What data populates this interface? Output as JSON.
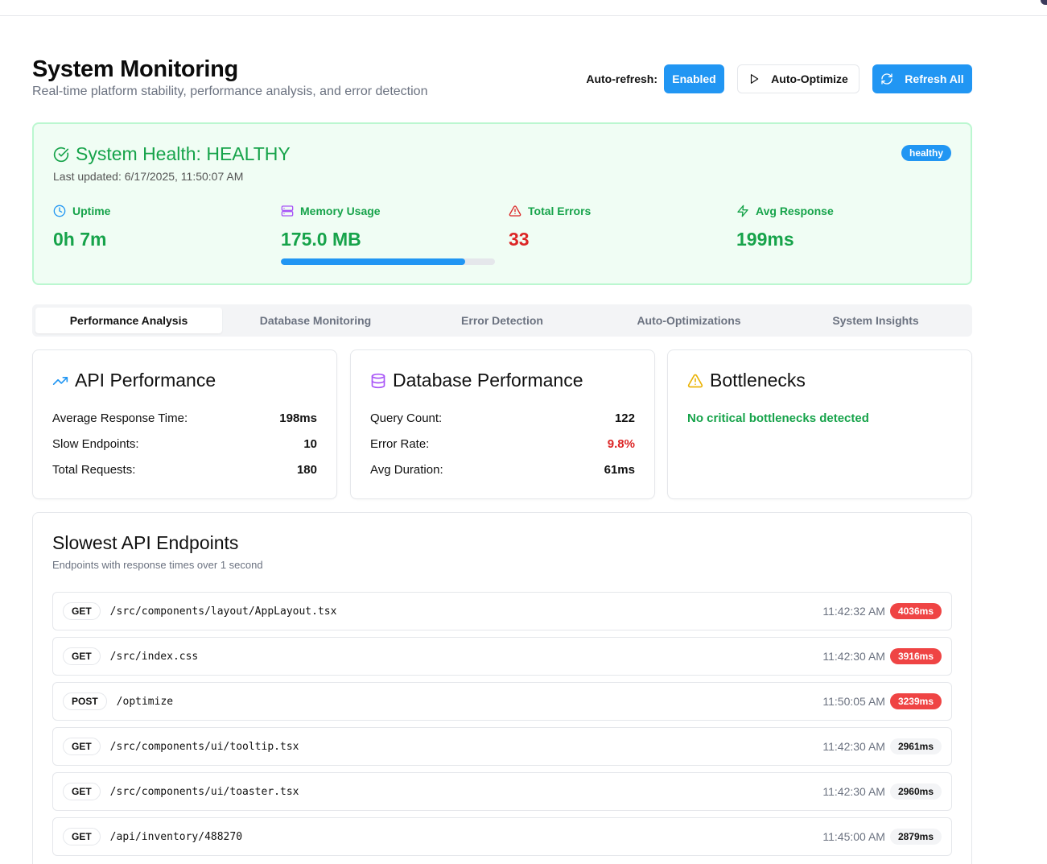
{
  "header": {
    "title": "System Monitoring",
    "subtitle": "Real-time platform stability, performance analysis, and error detection",
    "autorefresh_label": "Auto-refresh:",
    "autorefresh_button": "Enabled",
    "optimize_button": "Auto-Optimize",
    "refresh_button": "Refresh All"
  },
  "health": {
    "title": "System Health: HEALTHY",
    "last_updated": "Last updated: 6/17/2025, 11:50:07 AM",
    "badge": "healthy",
    "metrics": [
      {
        "label": "Uptime",
        "value": "0h 7m",
        "icon": "clock-icon"
      },
      {
        "label": "Memory Usage",
        "value": "175.0 MB",
        "icon": "server-icon",
        "usage_fraction": 0.86
      },
      {
        "label": "Total Errors",
        "value": "33",
        "icon": "alert-triangle-icon"
      },
      {
        "label": "Avg Response",
        "value": "199ms",
        "icon": "zap-icon"
      }
    ]
  },
  "tabs": [
    {
      "label": "Performance Analysis",
      "active": true
    },
    {
      "label": "Database Monitoring"
    },
    {
      "label": "Error Detection"
    },
    {
      "label": "Auto-Optimizations"
    },
    {
      "label": "System Insights"
    }
  ],
  "api_card": {
    "title": "API Performance",
    "rows": [
      {
        "label": "Average Response Time:",
        "value": "198ms"
      },
      {
        "label": "Slow Endpoints:",
        "value": "10"
      },
      {
        "label": "Total Requests:",
        "value": "180"
      }
    ]
  },
  "db_card": {
    "title": "Database Performance",
    "rows": [
      {
        "label": "Query Count:",
        "value": "122"
      },
      {
        "label": "Error Rate:",
        "value": "9.8%"
      },
      {
        "label": "Avg Duration:",
        "value": "61ms"
      }
    ]
  },
  "bottleneck_card": {
    "title": "Bottlenecks",
    "message": "No critical bottlenecks detected"
  },
  "endpoints": {
    "title": "Slowest API Endpoints",
    "subtitle": "Endpoints with response times over 1 second",
    "items": [
      {
        "method": "GET",
        "path": "/src/components/layout/AppLayout.tsx",
        "time": "11:42:32 AM",
        "duration": "4036ms",
        "severity": "red"
      },
      {
        "method": "GET",
        "path": "/src/index.css",
        "time": "11:42:30 AM",
        "duration": "3916ms",
        "severity": "red"
      },
      {
        "method": "POST",
        "path": "/optimize",
        "time": "11:50:05 AM",
        "duration": "3239ms",
        "severity": "red"
      },
      {
        "method": "GET",
        "path": "/src/components/ui/tooltip.tsx",
        "time": "11:42:30 AM",
        "duration": "2961ms",
        "severity": "gray"
      },
      {
        "method": "GET",
        "path": "/src/components/ui/toaster.tsx",
        "time": "11:42:30 AM",
        "duration": "2960ms",
        "severity": "gray"
      },
      {
        "method": "GET",
        "path": "/api/inventory/488270",
        "time": "11:45:00 AM",
        "duration": "2879ms",
        "severity": "gray"
      }
    ]
  },
  "colors": {
    "primary": "#2196f3",
    "success": "#16a34a",
    "danger": "#dc2626",
    "health_bg": "#f0fdf4"
  }
}
